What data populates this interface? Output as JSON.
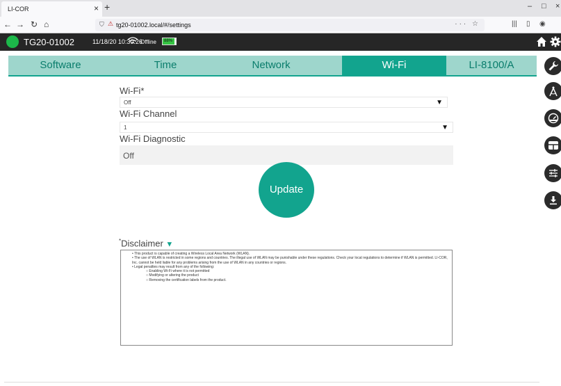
{
  "browser": {
    "tab_title": "LI-COR",
    "url": "tg20-01002.local/#/settings"
  },
  "header": {
    "device": "TG20-01002",
    "datetime": "11/18/20 10:30:26",
    "connection": "Offline",
    "battery": "88%",
    "battery_level": 0.88
  },
  "tabs": [
    {
      "label": "Software"
    },
    {
      "label": "Time"
    },
    {
      "label": "Network"
    },
    {
      "label": "Wi-Fi",
      "active": true
    },
    {
      "label": "LI-8100/A"
    }
  ],
  "form": {
    "wifi_label": "Wi-Fi*",
    "wifi_value": "Off",
    "channel_label": "Wi-Fi Channel",
    "channel_value": "1",
    "diagnostic_label": "Wi-Fi Diagnostic",
    "diagnostic_value": "Off",
    "update_label": "Update"
  },
  "disclaimer": {
    "title": "Disclaimer",
    "lines": [
      "This product is capable of creating a Wireless Local Area Network (WLAN).",
      "The use of WLAN is restricted in some regions and countries. The illegal use of WLAN may be punishable under these regulations. Check your local regulations to determine if WLAN is permitted. LI-COR, Inc. cannot be held liable for any problems arising from the use of WLAN in any countries or regions.",
      "Legal penalties may result from any of the following:"
    ],
    "sub_lines": [
      "Enabling Wi-Fi where it is not permitted",
      "Modifying or altering the product",
      "Removing the certification labels from the product."
    ]
  },
  "colors": {
    "accent": "#12a48e",
    "tab_bg": "#9ed6cc",
    "header_bg": "#262626",
    "status_online": "#1cb84a"
  },
  "icons": [
    "wrench-icon",
    "compass-icon",
    "gauge-icon",
    "layout-icon",
    "sliders-icon",
    "download-icon",
    "home-icon",
    "gear-icon"
  ]
}
